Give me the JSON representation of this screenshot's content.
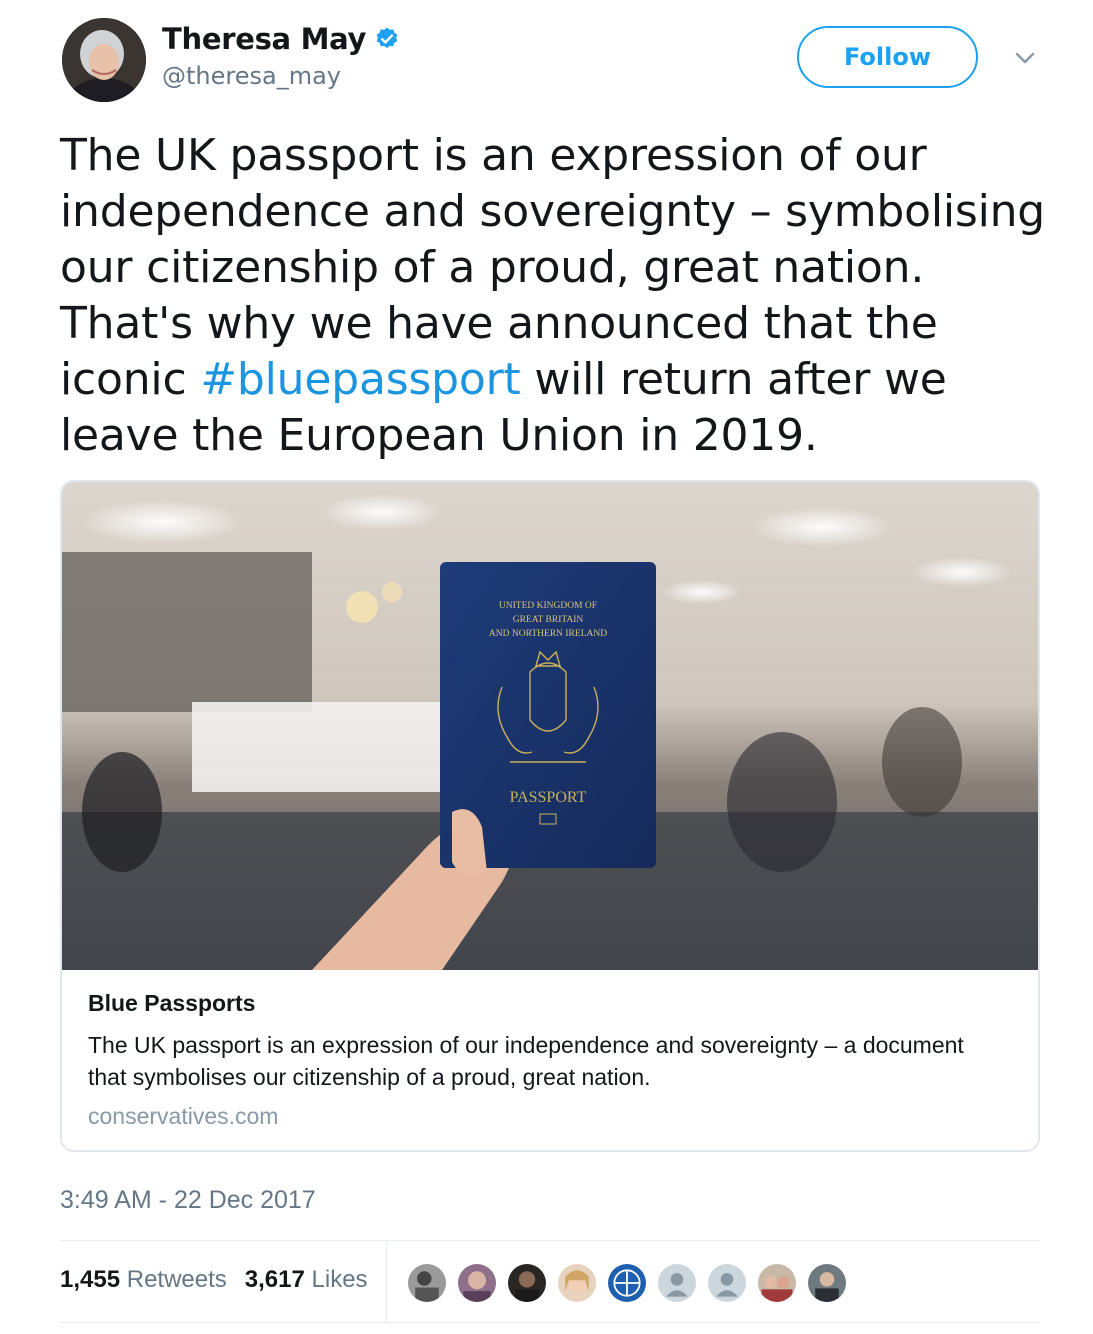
{
  "author": {
    "name": "Theresa May",
    "handle": "@theresa_may",
    "verified": true
  },
  "follow_label": "Follow",
  "tweet": {
    "text_before": "The UK passport is an expression of our independence and sovereignty – symbolising our citizenship of a proud, great nation. That's why we have announced that the iconic ",
    "hashtag": "#bluepassport",
    "text_after": " will return after we leave the European Union in 2019."
  },
  "card": {
    "image_text": {
      "line1": "UNITED KINGDOM OF",
      "line2": "GREAT BRITAIN",
      "line3": "AND NORTHERN IRELAND",
      "label": "PASSPORT"
    },
    "title": "Blue Passports",
    "description": "The UK passport is an expression of our independence and sovereignty – a document that symbolises our citizenship of a proud, great nation.",
    "domain": "conservatives.com"
  },
  "timestamp": "3:49 AM - 22 Dec 2017",
  "stats": {
    "retweets_count": "1,455",
    "retweets_label": "Retweets",
    "likes_count": "3,617",
    "likes_label": "Likes"
  },
  "colors": {
    "accent": "#1da1f2",
    "link": "#1b95e0",
    "muted": "#657786",
    "border": "#e1e8ed"
  }
}
